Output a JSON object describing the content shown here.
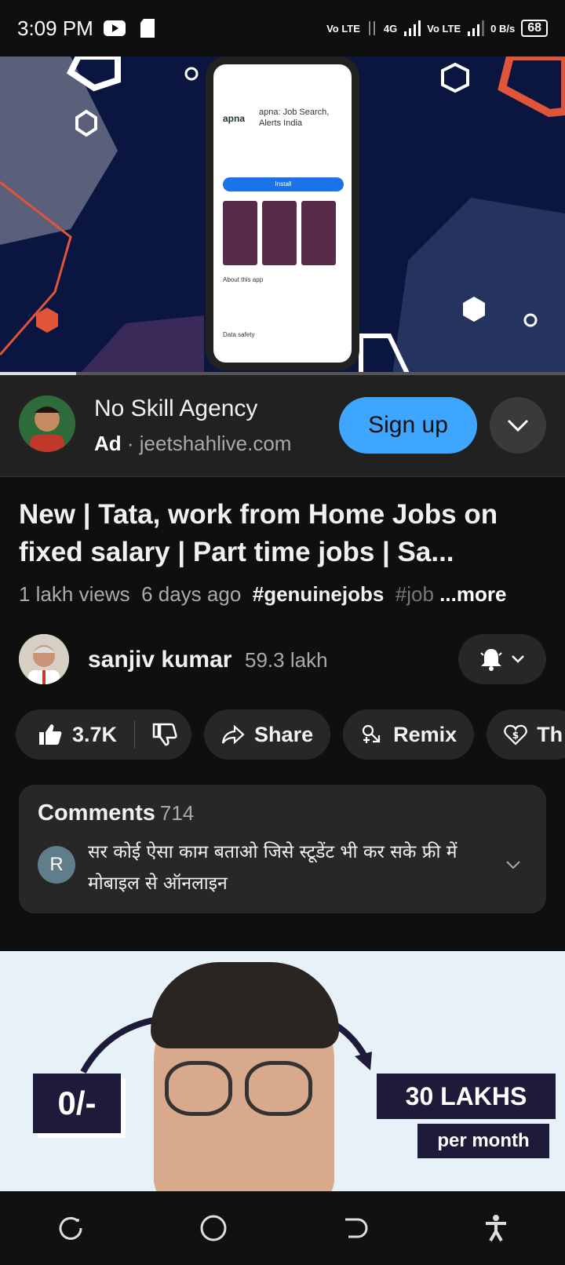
{
  "status_bar": {
    "time": "3:09 PM",
    "net1": "Vo LTE",
    "net2": "4G",
    "net3": "Vo LTE",
    "speed": "0 B/s",
    "battery": "68"
  },
  "video": {
    "progress_fraction": 0.135,
    "phone_app_name": "apna: Job Search, Alerts India",
    "phone_logo": "apna",
    "phone_install": "Install",
    "phone_about": "About this app",
    "phone_safety": "Data safety"
  },
  "ad": {
    "name": "No Skill Agency",
    "badge": "Ad",
    "domain": " · jeetshahlive.com",
    "cta": "Sign up"
  },
  "video_info": {
    "title": "New | Tata, work from Home Jobs on fixed salary | Part time jobs | Sa...",
    "views": "1 lakh views",
    "age": "6 days ago",
    "tag1": "#genuinejobs",
    "tag2": "#job",
    "more": "...more"
  },
  "channel": {
    "name": "sanjiv kumar",
    "subscribers": "59.3 lakh"
  },
  "actions": {
    "likes": "3.7K",
    "share": "Share",
    "remix": "Remix",
    "thanks": "Th"
  },
  "comments": {
    "label": "Comments",
    "count": "714",
    "avatar_letter": "R",
    "top_comment": "सर कोई ऐसा काम बताओ जिसे स्टूडेंट भी कर सके फ्री में मोबाइल से ऑनलाइन"
  },
  "next_thumbnail": {
    "left_label": "0/-",
    "right_label": "30 LAKHS",
    "right_sub": "per month"
  },
  "colors": {
    "accent_blue": "#3ea6ff",
    "background": "#0f0f0f",
    "card": "#272727"
  }
}
